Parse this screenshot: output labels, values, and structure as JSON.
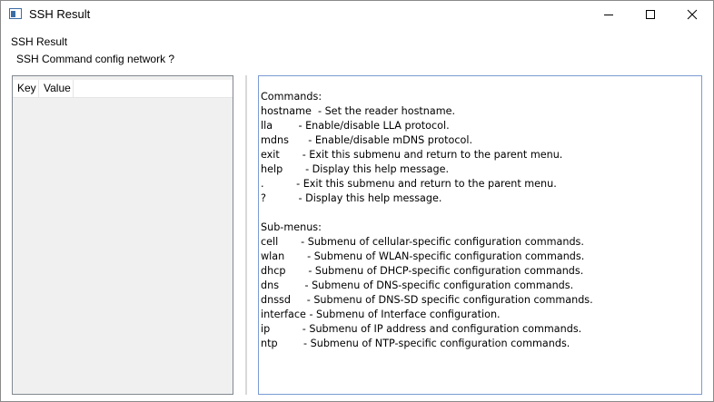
{
  "window": {
    "title": "SSH Result"
  },
  "header": {
    "label": "SSH Result",
    "command": "SSH Command config network ?"
  },
  "kv_table": {
    "columns": [
      "Key",
      "Value"
    ],
    "rows": []
  },
  "output": {
    "text": "Commands:\nhostname  - Set the reader hostname.\nlla        - Enable/disable LLA protocol.\nmdns      - Enable/disable mDNS protocol.\nexit       - Exit this submenu and return to the parent menu.\nhelp       - Display this help message.\n.          - Exit this submenu and return to the parent menu.\n?          - Display this help message.\n\nSub-menus:\ncell       - Submenu of cellular-specific configuration commands.\nwlan       - Submenu of WLAN-specific configuration commands.\ndhcp       - Submenu of DHCP-specific configuration commands.\ndns        - Submenu of DNS-specific configuration commands.\ndnssd     - Submenu of DNS-SD specific configuration commands.\ninterface - Submenu of Interface configuration.\nip          - Submenu of IP address and configuration commands.\nntp        - Submenu of NTP-specific configuration commands."
  },
  "icons": {
    "app": "app-window-icon",
    "minimize": "minimize-icon",
    "maximize": "maximize-icon",
    "close": "close-icon"
  }
}
